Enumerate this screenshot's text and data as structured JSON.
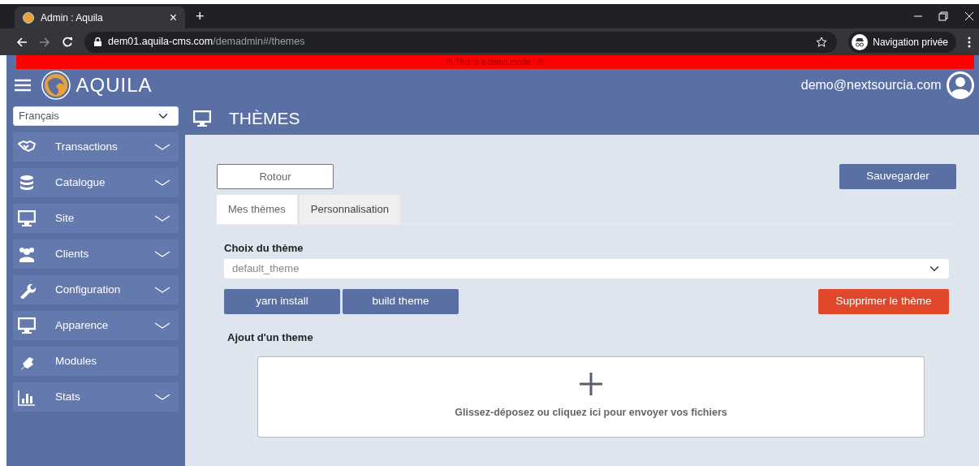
{
  "browser": {
    "tab_title": "Admin : Aquila",
    "tab_close": "×",
    "new_tab": "+",
    "url_host": "dem01.aquila-cms.com",
    "url_path": "/demadmin#/themes",
    "profile": "Navigation privée"
  },
  "demo_banner": "/!\\ This is a demo mode ! /!\\",
  "header": {
    "brand": "AQUILA",
    "user": "demo@nextsourcia.com"
  },
  "sidebar": {
    "language": "Français",
    "items": [
      {
        "label": "Transactions",
        "kind": "menu"
      },
      {
        "label": "Catalogue",
        "kind": "menu"
      },
      {
        "label": "Site",
        "kind": "menu"
      },
      {
        "label": "Clients",
        "kind": "menu"
      },
      {
        "label": "Configuration",
        "kind": "menu"
      },
      {
        "label": "Apparence",
        "kind": "menu"
      },
      {
        "label": "Modules",
        "kind": "link"
      },
      {
        "label": "Stats",
        "kind": "menu"
      }
    ]
  },
  "page_title": "THÈMES",
  "back_button": "Rotour",
  "save_button": "Sauvegarder",
  "tabs": [
    {
      "label": "Mes thèmes",
      "selected": true
    },
    {
      "label": "Personnalisation",
      "selected": false
    }
  ],
  "theme_select": {
    "label": "Choix du thème",
    "value": "default_theme"
  },
  "actions": [
    {
      "label": "yarn install",
      "kind": "primary"
    },
    {
      "label": "build theme",
      "kind": "primary"
    },
    {
      "label": "Supprimer le thème",
      "kind": "danger"
    }
  ],
  "upload": {
    "heading": "Ajout d'un theme",
    "hint": "Glissez-déposez ou cliquez ici pour envoyer vos fichiers"
  }
}
